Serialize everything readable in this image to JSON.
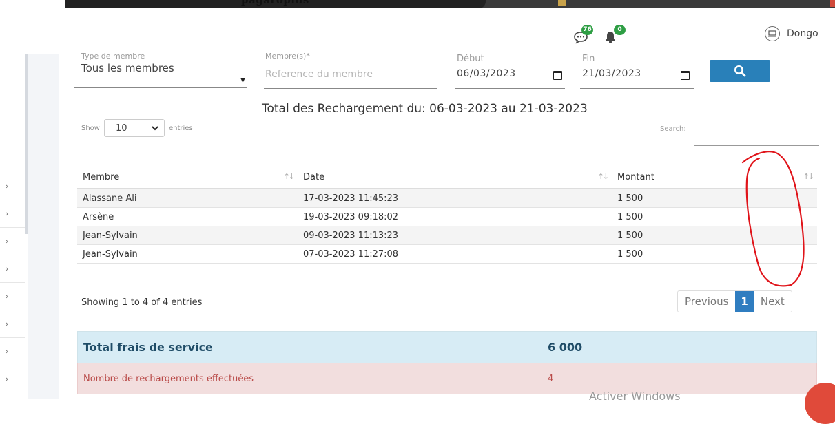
{
  "browser": {
    "title_fragment": "pagaroplus"
  },
  "header": {
    "messages_count": "76",
    "notifications_count": "0",
    "user_name": "Dongo"
  },
  "filters": {
    "type_label": "Type de membre",
    "type_value": "Tous les membres",
    "membre_label": "Membre(s)*",
    "membre_placeholder": "Reference du membre",
    "debut_label": "Début",
    "debut_value": "06/03/2023",
    "fin_label": "Fin",
    "fin_value": "21/03/2023"
  },
  "report_title": "Total des Rechargement du: 06-03-2023 au 21-03-2023",
  "length_menu": {
    "show": "Show",
    "value": "10",
    "entries": "entries"
  },
  "search_label": "Search:",
  "table": {
    "headers": [
      "Membre",
      "Date",
      "Montant"
    ],
    "rows": [
      {
        "membre": "Alassane Ali",
        "date": "17-03-2023 11:45:23",
        "montant": "1 500"
      },
      {
        "membre": "Arsène",
        "date": "19-03-2023 09:18:02",
        "montant": "1 500"
      },
      {
        "membre": "Jean-Sylvain",
        "date": "09-03-2023 11:13:23",
        "montant": "1 500"
      },
      {
        "membre": "Jean-Sylvain",
        "date": "07-03-2023 11:27:08",
        "montant": "1 500"
      }
    ]
  },
  "info": "Showing 1 to 4 of 4 entries",
  "pagination": {
    "previous": "Previous",
    "current": "1",
    "next": "Next"
  },
  "totals": {
    "frais_label": "Total frais de service",
    "frais_value": "6 000",
    "nombre_label": "Nombre de rechargements effectuées",
    "nombre_value": "4"
  },
  "watermark": "Activer Windows",
  "colors": {
    "primary": "#2980b9",
    "badge": "#2e9e44",
    "info_bg": "#d7ecf5",
    "danger_bg": "#f2dede",
    "annotation": "#e0141a"
  }
}
